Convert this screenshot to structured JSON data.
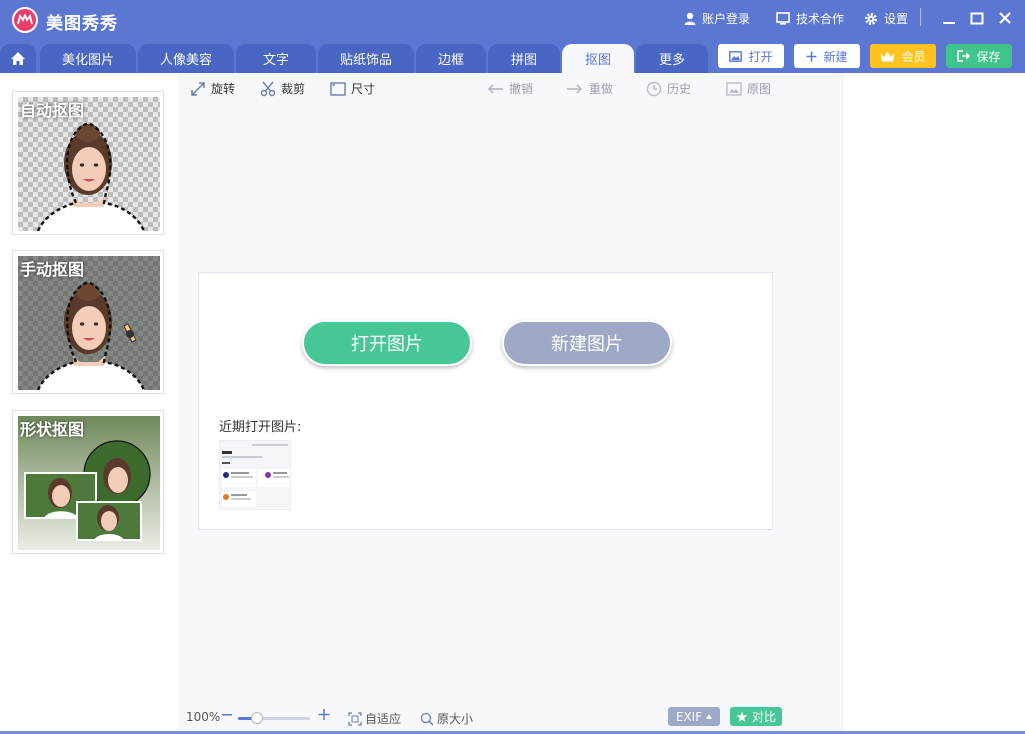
{
  "app": {
    "title": "美图秀秀"
  },
  "top_links": {
    "login": "账户登录",
    "cooperation": "技术合作",
    "settings": "设置"
  },
  "tabs": [
    {
      "label": "美化图片"
    },
    {
      "label": "人像美容"
    },
    {
      "label": "文字"
    },
    {
      "label": "贴纸饰品"
    },
    {
      "label": "边框"
    },
    {
      "label": "拼图"
    },
    {
      "label": "抠图",
      "active": true
    },
    {
      "label": "更多"
    }
  ],
  "actions": {
    "open": "打开",
    "new": "新建",
    "vip": "会员",
    "save": "保存"
  },
  "left_panel": {
    "cards": [
      {
        "label": "自动抠图"
      },
      {
        "label": "手动抠图"
      },
      {
        "label": "形状抠图"
      }
    ]
  },
  "toolbar": {
    "rotate": "旋转",
    "crop": "裁剪",
    "size": "尺寸",
    "undo": "撤销",
    "redo": "重做",
    "history": "历史",
    "original": "原图"
  },
  "start": {
    "open_image": "打开图片",
    "new_image": "新建图片",
    "recent_label": "近期打开图片:"
  },
  "status": {
    "zoom_percent": "100%",
    "zoom_level": 0.27,
    "fit": "自适应",
    "actual_size": "原大小",
    "exif": "EXIF",
    "compare": "对比"
  },
  "colors": {
    "header": "#5b77d2",
    "tab": "#4a66c5",
    "accent_green": "#47c796",
    "vip_gold": "#ffc21e",
    "gray_button": "#9da9c6"
  }
}
